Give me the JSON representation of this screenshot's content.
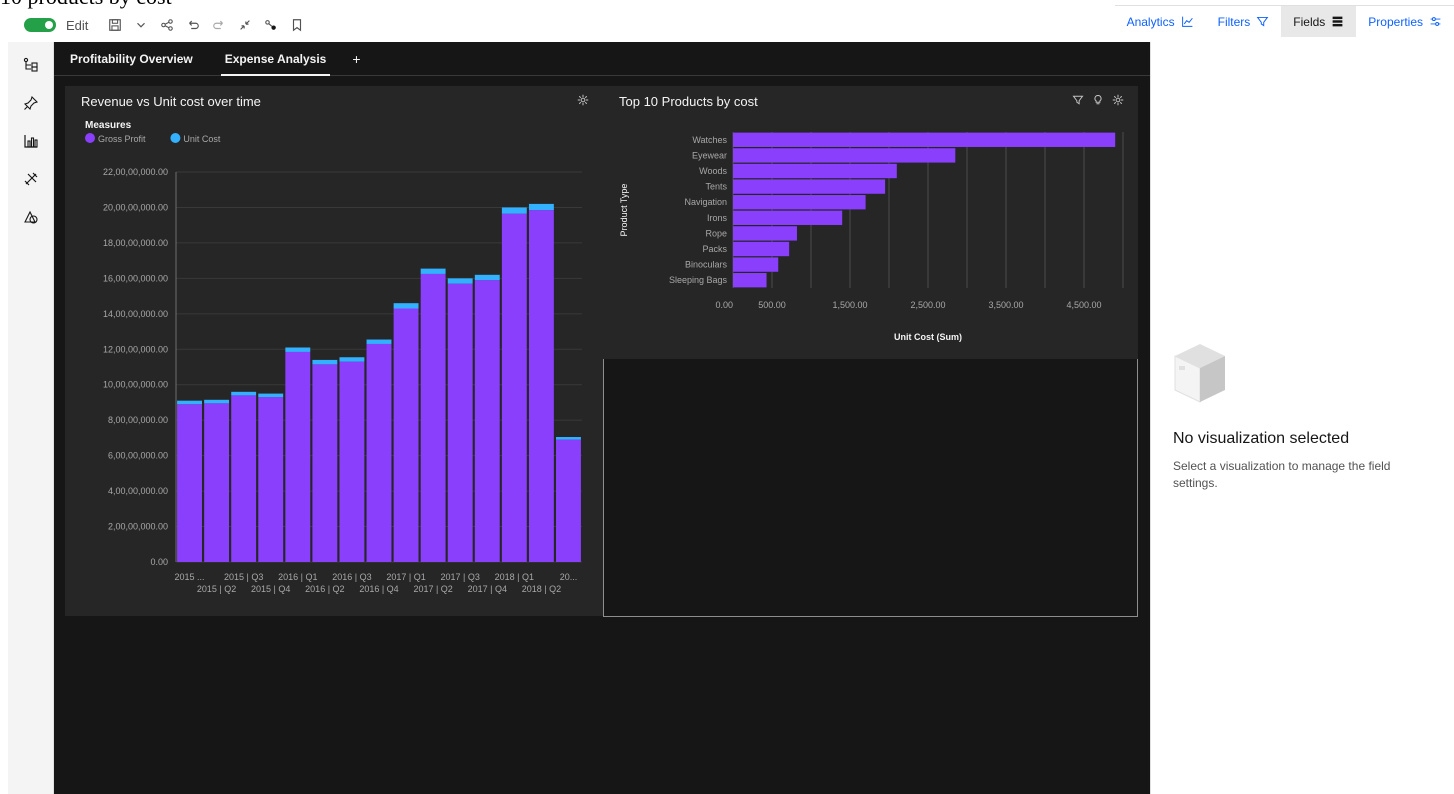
{
  "page_title_fragment": "10 products by cost",
  "toolbar": {
    "edit_label": "Edit",
    "toggle_on": true,
    "tabs": [
      {
        "label": "Analytics",
        "icon": "analytics-icon",
        "active": false
      },
      {
        "label": "Filters",
        "icon": "filter-icon",
        "active": false
      },
      {
        "label": "Fields",
        "icon": "fields-icon",
        "active": true
      },
      {
        "label": "Properties",
        "icon": "properties-icon",
        "active": false
      }
    ]
  },
  "rail": {
    "items": [
      "data-sources-icon",
      "pin-icon",
      "visualizations-icon",
      "tools-icon",
      "shapes-icon"
    ]
  },
  "canvas": {
    "tabs": [
      {
        "label": "Profitability Overview",
        "active": false
      },
      {
        "label": "Expense Analysis",
        "active": true
      }
    ],
    "add_tab": "+"
  },
  "widget1": {
    "title": "Revenue vs Unit cost over time",
    "legend_title": "Measures",
    "legend": [
      {
        "name": "Gross Profit",
        "color": "#8a3ffc"
      },
      {
        "name": "Unit Cost",
        "color": "#33b1ff"
      }
    ]
  },
  "widget2": {
    "title": "Top 10 Products by cost"
  },
  "right_panel": {
    "title": "No visualization selected",
    "description": "Select a visualization to manage the field settings."
  },
  "chart_data": [
    {
      "type": "bar",
      "stacked": true,
      "title": "Revenue vs Unit cost over time",
      "ylim": [
        0,
        220000000
      ],
      "y_ticks": [
        "0.00",
        "2,00,00,000.00",
        "4,00,00,000.00",
        "6,00,00,000.00",
        "8,00,00,000.00",
        "10,00,00,000.00",
        "12,00,00,000.00",
        "14,00,00,000.00",
        "16,00,00,000.00",
        "18,00,00,000.00",
        "20,00,00,000.00",
        "22,00,00,000.00"
      ],
      "x_labels_top": [
        "2015 ...",
        "2015 | Q3",
        "2016 | Q1",
        "2016 | Q3",
        "2017 | Q1",
        "2017 | Q3",
        "2018 | Q1",
        "20..."
      ],
      "x_labels_bottom": [
        "2015 | Q2",
        "2015 | Q4",
        "2016 | Q2",
        "2016 | Q4",
        "2017 | Q2",
        "2017 | Q4",
        "2018 | Q2"
      ],
      "categories": [
        "2015 | Q1",
        "2015 | Q2",
        "2015 | Q3",
        "2015 | Q4",
        "2016 | Q1",
        "2016 | Q2",
        "2016 | Q3",
        "2016 | Q4",
        "2017 | Q1",
        "2017 | Q2",
        "2017 | Q3",
        "2017 | Q4",
        "2018 | Q1",
        "2018 | Q2",
        "2018 | Q3"
      ],
      "series": [
        {
          "name": "Gross Profit",
          "color": "#8a3ffc",
          "values": [
            89000000,
            89500000,
            94000000,
            93000000,
            118500000,
            111500000,
            113000000,
            123000000,
            143000000,
            162500000,
            157000000,
            159000000,
            196500000,
            198500000,
            69000000
          ]
        },
        {
          "name": "Unit Cost",
          "color": "#33b1ff",
          "values": [
            2000000,
            2000000,
            2000000,
            2000000,
            2500000,
            2500000,
            2500000,
            2500000,
            3000000,
            3000000,
            3000000,
            3000000,
            3500000,
            3500000,
            1500000
          ]
        }
      ]
    },
    {
      "type": "bar",
      "orientation": "horizontal",
      "title": "Top 10 Products by cost",
      "xlabel": "Unit Cost (Sum)",
      "ylabel": "Product Type",
      "xlim": [
        0,
        5000
      ],
      "x_ticks": [
        "0.00",
        "500.00",
        "1,500.00",
        "2,500.00",
        "3,500.00",
        "4,500.00"
      ],
      "categories": [
        "Watches",
        "Eyewear",
        "Woods",
        "Tents",
        "Navigation",
        "Irons",
        "Rope",
        "Packs",
        "Binoculars",
        "Sleeping Bags"
      ],
      "values": [
        4900,
        2850,
        2100,
        1950,
        1700,
        1400,
        820,
        720,
        580,
        430
      ],
      "color": "#8a3ffc"
    }
  ]
}
